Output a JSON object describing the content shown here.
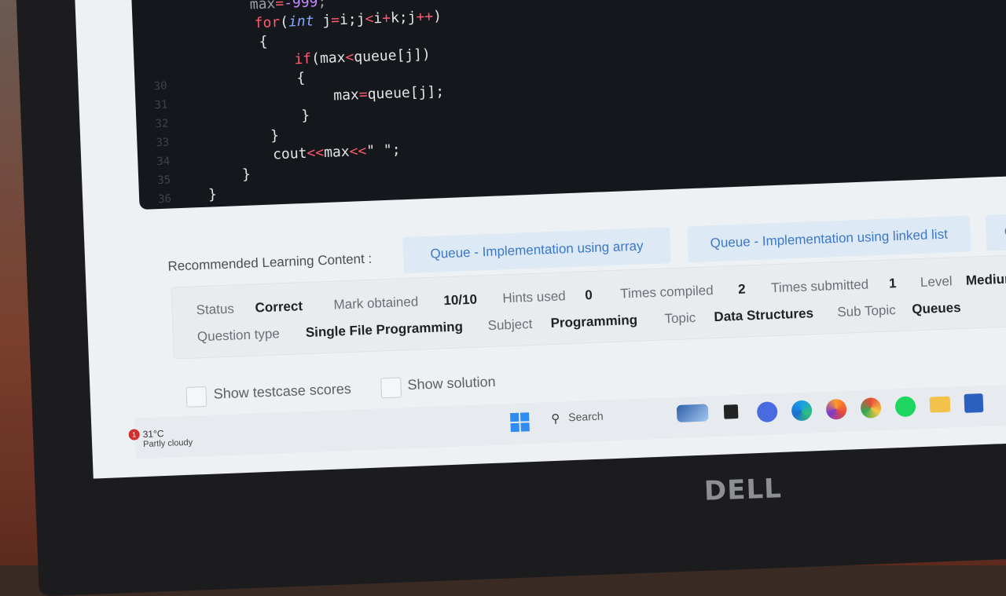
{
  "code": {
    "line_numbers": [
      "30",
      "31",
      "32",
      "33",
      "34",
      "35",
      "36"
    ],
    "lines": {
      "l0": {
        "a": "max",
        "b": "=",
        "c": "-999",
        ";": ";"
      },
      "l1": "for(int j=i;j<i+k;j++)",
      "l2": "{",
      "l3": "if(max<queue[j])",
      "l4": "{",
      "l5": "max=queue[j];",
      "l6": "}",
      "l7": "}",
      "l8": "cout<<max<<\" \";",
      "l9": "}",
      "l10": "}"
    }
  },
  "learning": {
    "label": "Recommended Learning Content :",
    "chips": [
      "Queue - Implementation using array",
      "Queue - Implementation using linked list",
      "Q"
    ]
  },
  "stats": {
    "status_label": "Status",
    "status_value": "Correct",
    "mark_label": "Mark obtained",
    "mark_value": "10/10",
    "hints_label": "Hints used",
    "hints_value": "0",
    "compiled_label": "Times compiled",
    "compiled_value": "2",
    "submitted_label": "Times submitted",
    "submitted_value": "1",
    "level_label": "Level",
    "level_value": "Medium",
    "qtype_label": "Question type",
    "qtype_value": "Single File Programming",
    "subject_label": "Subject",
    "subject_value": "Programming",
    "topic_label": "Topic",
    "topic_value": "Data Structures",
    "subtopic_label": "Sub Topic",
    "subtopic_value": "Queues"
  },
  "options": {
    "testcase_label": "Show testcase scores",
    "solution_label": "Show solution"
  },
  "taskbar": {
    "search_label": "Search",
    "weather_temp": "31°C",
    "weather_desc": "Partly cloudy",
    "notification_count": "1"
  },
  "brand": "DELL",
  "colors": {
    "code_bg": "#14171c",
    "chip_bg": "#dde9f4",
    "chip_text": "#3d78c8"
  }
}
